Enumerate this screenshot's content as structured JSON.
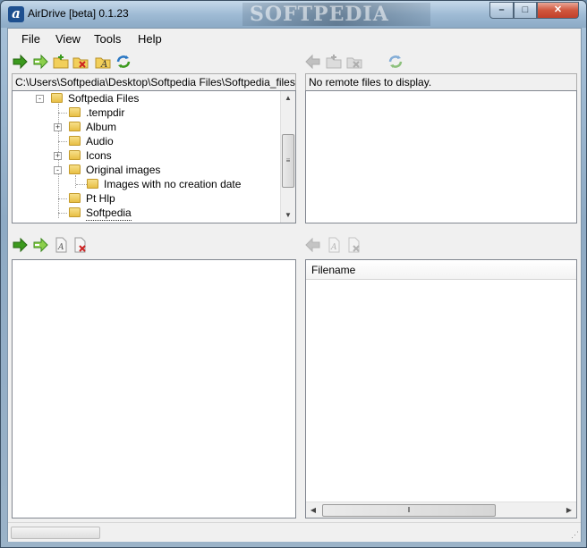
{
  "window": {
    "title": "AirDrive [beta] 0.1.23",
    "watermark": "SOFTPEDIA",
    "app_icon": "a"
  },
  "menu": {
    "items": [
      {
        "label": "File"
      },
      {
        "label": "View"
      },
      {
        "label": "Tools"
      },
      {
        "label": "Help"
      }
    ]
  },
  "local": {
    "toolbar_icons": [
      "upload-arrow-icon",
      "upload-folder-icon",
      "new-folder-icon",
      "delete-folder-icon",
      "rename-icon",
      "refresh-icon"
    ],
    "path": "C:\\Users\\Softpedia\\Desktop\\Softpedia Files\\Softpedia_files",
    "tree": [
      {
        "label": "Softpedia Files",
        "expander": "-"
      },
      {
        "label": ".tempdir",
        "expander": ""
      },
      {
        "label": "Album",
        "expander": "+"
      },
      {
        "label": "Audio",
        "expander": ""
      },
      {
        "label": "Icons",
        "expander": "+"
      },
      {
        "label": "Original images",
        "expander": "-"
      },
      {
        "label": "Images with no creation date",
        "expander": ""
      },
      {
        "label": "Pt Hlp",
        "expander": ""
      },
      {
        "label": "Softpedia",
        "expander": ""
      }
    ],
    "file_toolbar_icons": [
      "upload-file-icon",
      "upload-all-icon",
      "rename-file-icon",
      "delete-file-icon"
    ]
  },
  "remote": {
    "toolbar_icons": [
      "download-icon",
      "new-remote-folder-icon",
      "delete-remote-icon",
      "refresh-remote-icon"
    ],
    "status": "No remote files to display.",
    "file_toolbar_icons": [
      "download-file-icon",
      "rename-remote-file-icon",
      "delete-remote-file-icon"
    ],
    "columns": [
      "Filename"
    ]
  },
  "colors": {
    "accent_green": "#3c9a1e",
    "delete_red": "#cc2222",
    "folder_yellow": "#e8bf45"
  }
}
